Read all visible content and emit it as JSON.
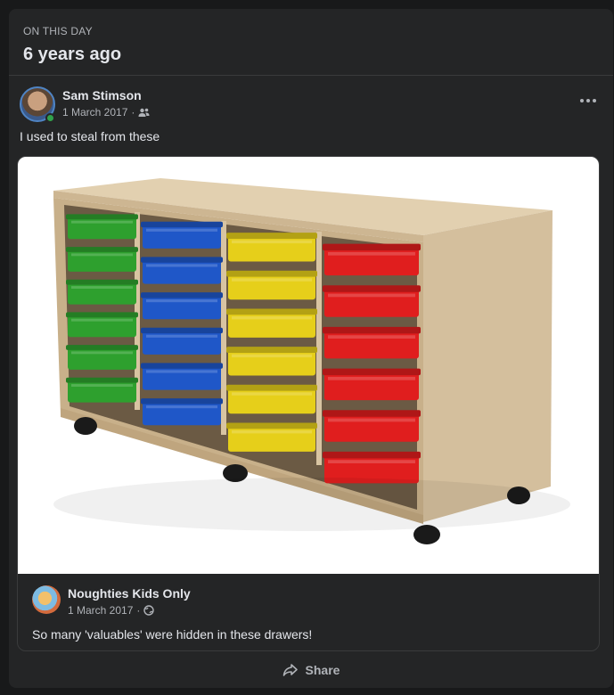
{
  "memory": {
    "label": "ON THIS DAY",
    "title": "6 years ago"
  },
  "post": {
    "author": "Sam Stimson",
    "date": "1 March 2017",
    "audience_icon": "friends-icon",
    "text": "I used to steal from these"
  },
  "shared": {
    "page_name": "Noughties Kids Only",
    "date": "1 March 2017",
    "audience_icon": "globe-icon",
    "text": "So many 'valuables' were hidden in these drawers!"
  },
  "actions": {
    "share_label": "Share"
  },
  "colors": {
    "tray_green": "#2ea02e",
    "tray_blue": "#1f57c8",
    "tray_yellow": "#e6cf1a",
    "tray_red": "#e01e1e",
    "cabinet_wood": "#d8c4a2"
  }
}
